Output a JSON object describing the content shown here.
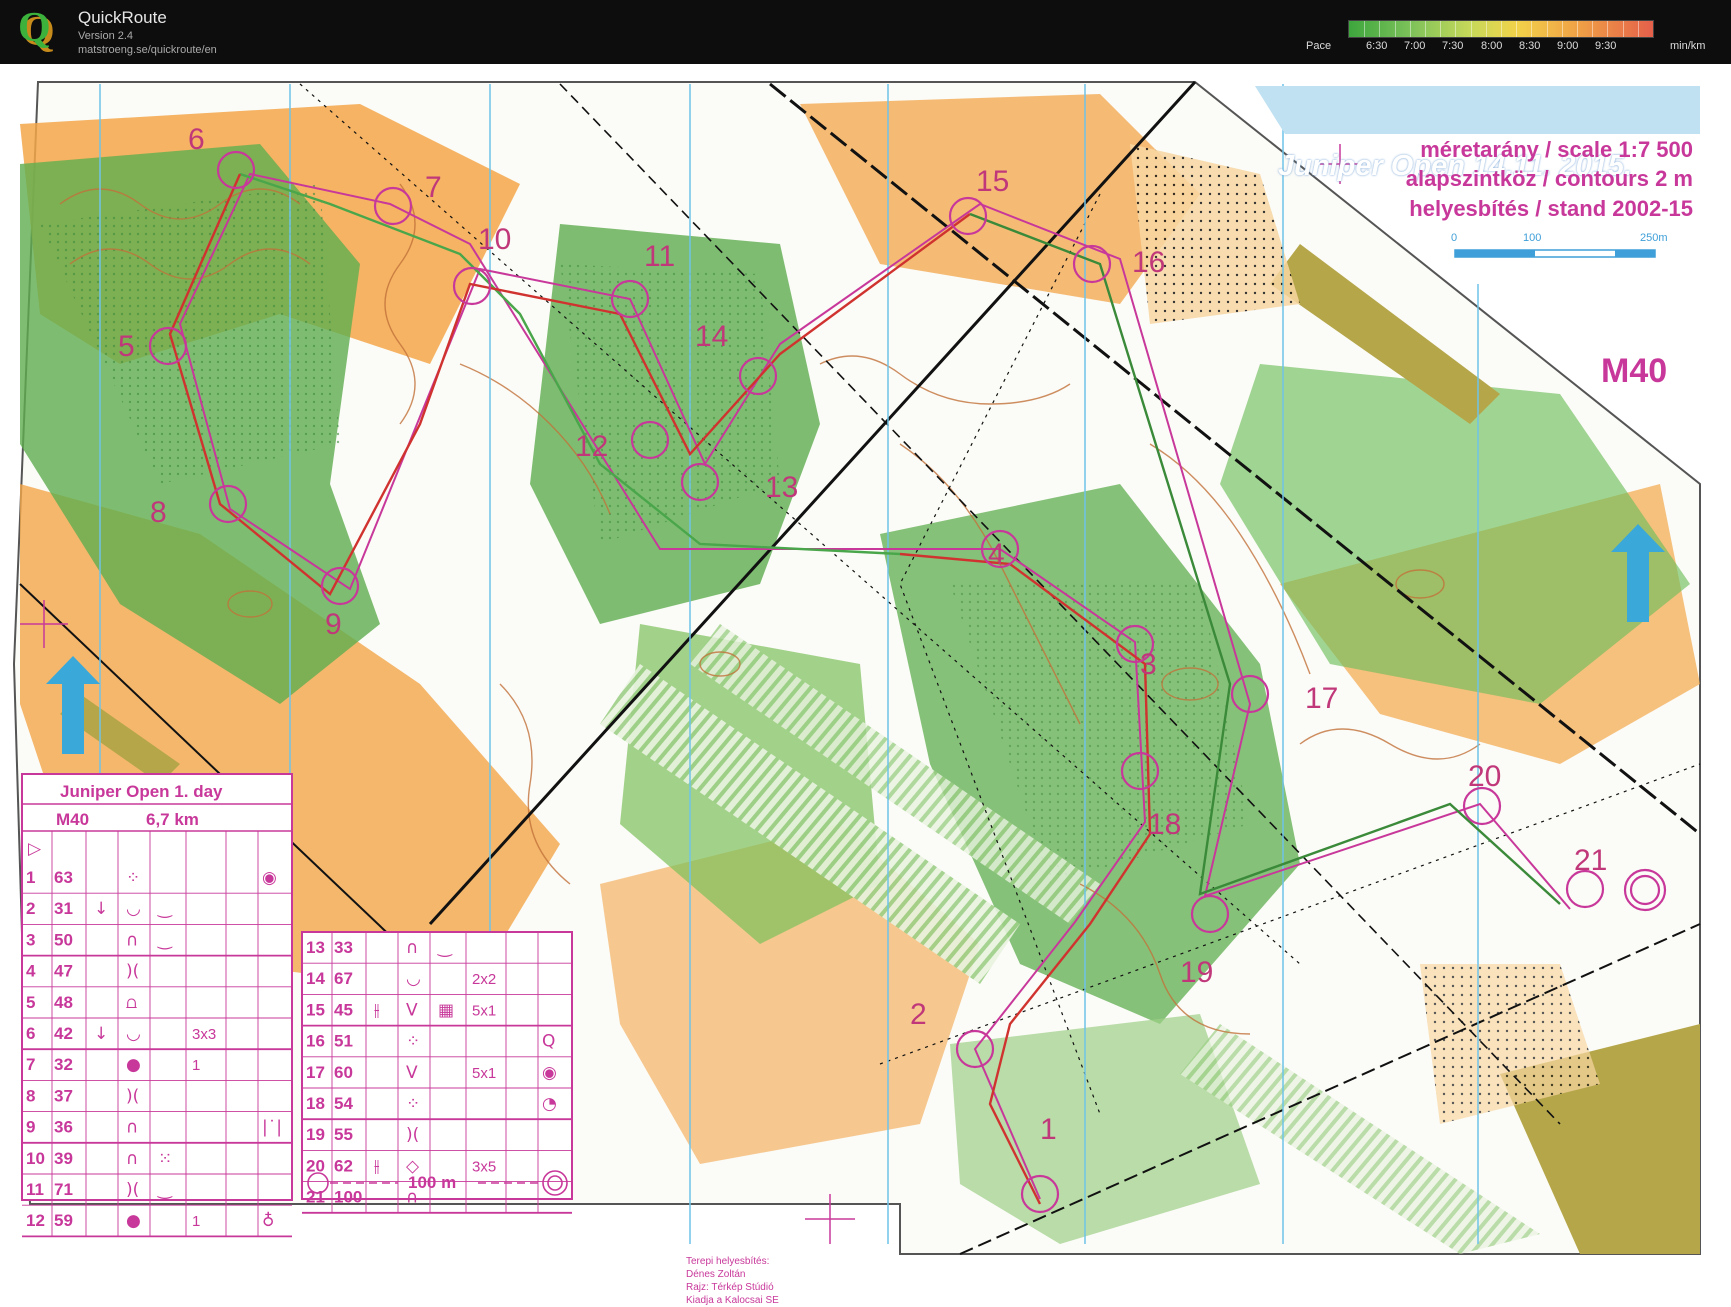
{
  "app": {
    "name": "QuickRoute",
    "version": "Version 2.4",
    "url": "matstroeng.se/quickroute/en"
  },
  "pace_legend": {
    "label": "Pace",
    "unit": "min/km",
    "ticks": [
      "6:30",
      "7:00",
      "7:30",
      "8:00",
      "8:30",
      "9:00",
      "9:30"
    ]
  },
  "map": {
    "event_title": "Juniper Open 14.11. 2015.",
    "scale_line": "méretarány / scale   1:7 500",
    "contours_line": "alapszintköz / contours 2 m",
    "stand_line": "helyesbítés / stand  2002-15",
    "scalebar_ticks": [
      "0",
      "100",
      "250m"
    ],
    "class_label": "M40",
    "control_numbers": [
      "1",
      "2",
      "3",
      "4",
      "5",
      "6",
      "7",
      "8",
      "9",
      "10",
      "11",
      "12",
      "13",
      "14",
      "15",
      "16",
      "17",
      "18",
      "19",
      "20",
      "21"
    ],
    "credits": [
      "Terepi helyesbítés:",
      "Dénes Zoltán",
      "Rajz: Térkép Stúdió",
      "Kiadja a Kalocsai SE"
    ]
  },
  "control_card": {
    "title": "Juniper Open 1. day",
    "class": "M40",
    "length": "6,7 km",
    "start_symbol": "▷",
    "rows_left": [
      {
        "no": "1",
        "code": "63",
        "dir": "",
        "feature": "⁘",
        "detail": "",
        "dim": "",
        "extra": "◉"
      },
      {
        "no": "2",
        "code": "31",
        "dir": "↓",
        "feature": "◡",
        "detail": "‿",
        "dim": "",
        "extra": ""
      },
      {
        "no": "3",
        "code": "50",
        "dir": "",
        "feature": "∩",
        "detail": "‿",
        "dim": "",
        "extra": ""
      },
      {
        "no": "4",
        "code": "47",
        "dir": "",
        "feature": ")(",
        "detail": "",
        "dim": "",
        "extra": ""
      },
      {
        "no": "5",
        "code": "48",
        "dir": "",
        "feature": "⩍",
        "detail": "",
        "dim": "",
        "extra": ""
      },
      {
        "no": "6",
        "code": "42",
        "dir": "↓",
        "feature": "◡",
        "detail": "",
        "dim": "3x3",
        "extra": ""
      },
      {
        "no": "7",
        "code": "32",
        "dir": "",
        "feature": "●",
        "detail": "",
        "dim": "1",
        "extra": ""
      },
      {
        "no": "8",
        "code": "37",
        "dir": "",
        "feature": ")(",
        "detail": "",
        "dim": "",
        "extra": ""
      },
      {
        "no": "9",
        "code": "36",
        "dir": "",
        "feature": "∩",
        "detail": "",
        "dim": "",
        "extra": "|˙|"
      },
      {
        "no": "10",
        "code": "39",
        "dir": "",
        "feature": "∩",
        "detail": "⁙",
        "dim": "",
        "extra": ""
      },
      {
        "no": "11",
        "code": "71",
        "dir": "",
        "feature": ")(",
        "detail": "‿",
        "dim": "",
        "extra": ""
      },
      {
        "no": "12",
        "code": "59",
        "dir": "",
        "feature": "●",
        "detail": "",
        "dim": "1",
        "extra": "♁"
      }
    ],
    "rows_right": [
      {
        "no": "13",
        "code": "33",
        "dir": "",
        "feature": "∩",
        "detail": "‿",
        "dim": "",
        "extra": ""
      },
      {
        "no": "14",
        "code": "67",
        "dir": "",
        "feature": "◡",
        "detail": "",
        "dim": "2x2",
        "extra": ""
      },
      {
        "no": "15",
        "code": "45",
        "dir": "⫲",
        "feature": "V",
        "detail": "▦",
        "dim": "5x1",
        "extra": ""
      },
      {
        "no": "16",
        "code": "51",
        "dir": "",
        "feature": "⁘",
        "detail": "",
        "dim": "",
        "extra": "Q"
      },
      {
        "no": "17",
        "code": "60",
        "dir": "",
        "feature": "V",
        "detail": "",
        "dim": "5x1",
        "extra": "◉"
      },
      {
        "no": "18",
        "code": "54",
        "dir": "",
        "feature": "⁘",
        "detail": "",
        "dim": "",
        "extra": "◔"
      },
      {
        "no": "19",
        "code": "55",
        "dir": "",
        "feature": ")(",
        "detail": "",
        "dim": "",
        "extra": ""
      },
      {
        "no": "20",
        "code": "62",
        "dir": "⫲",
        "feature": "◇",
        "detail": "",
        "dim": "3x5",
        "extra": ""
      },
      {
        "no": "21",
        "code": "100",
        "dir": "",
        "feature": "∩",
        "detail": "",
        "dim": "",
        "extra": ""
      }
    ],
    "finish_text": "100 m"
  },
  "colors": {
    "topbar": "#0d0d0d",
    "magenta": "#c8389a",
    "forest_green": "#5fae4f",
    "open_orange": "#f3a649",
    "contour_brown": "#c2723a",
    "north_blue": "#3aa8d8"
  }
}
